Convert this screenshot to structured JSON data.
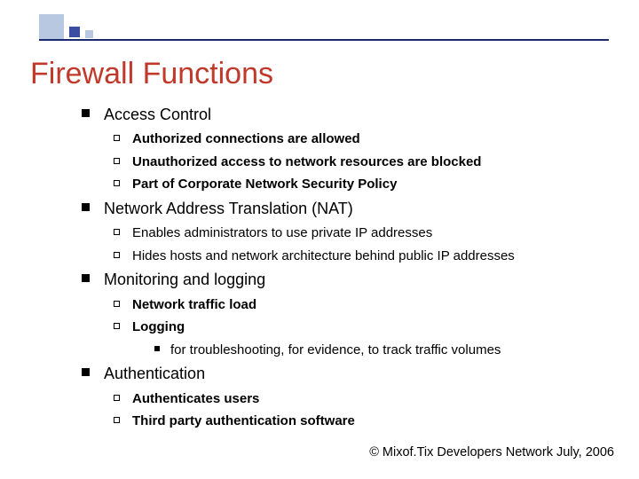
{
  "title": "Firewall Functions",
  "sections": [
    {
      "heading": "Access Control",
      "items": [
        {
          "text": "Authorized connections are allowed",
          "bold": true
        },
        {
          "text": "Unauthorized access to network resources are blocked",
          "bold": true
        },
        {
          "text": "Part of Corporate Network Security Policy",
          "bold": true
        }
      ]
    },
    {
      "heading": "Network Address Translation (NAT)",
      "items": [
        {
          "text": "Enables administrators to use private IP addresses",
          "bold": false
        },
        {
          "text": "Hides hosts and network architecture behind public IP addresses",
          "bold": false
        }
      ]
    },
    {
      "heading": "Monitoring and logging",
      "items": [
        {
          "text": "Network traffic load",
          "bold": true
        },
        {
          "text": "Logging",
          "bold": true,
          "sub": [
            "for troubleshooting, for evidence, to track traffic volumes"
          ]
        }
      ]
    },
    {
      "heading": "Authentication",
      "items": [
        {
          "text": "Authenticates users",
          "bold": true
        },
        {
          "text": "Third party authentication software",
          "bold": true
        }
      ]
    }
  ],
  "footer": "© Mixof.Tix Developers Network July, 2006"
}
